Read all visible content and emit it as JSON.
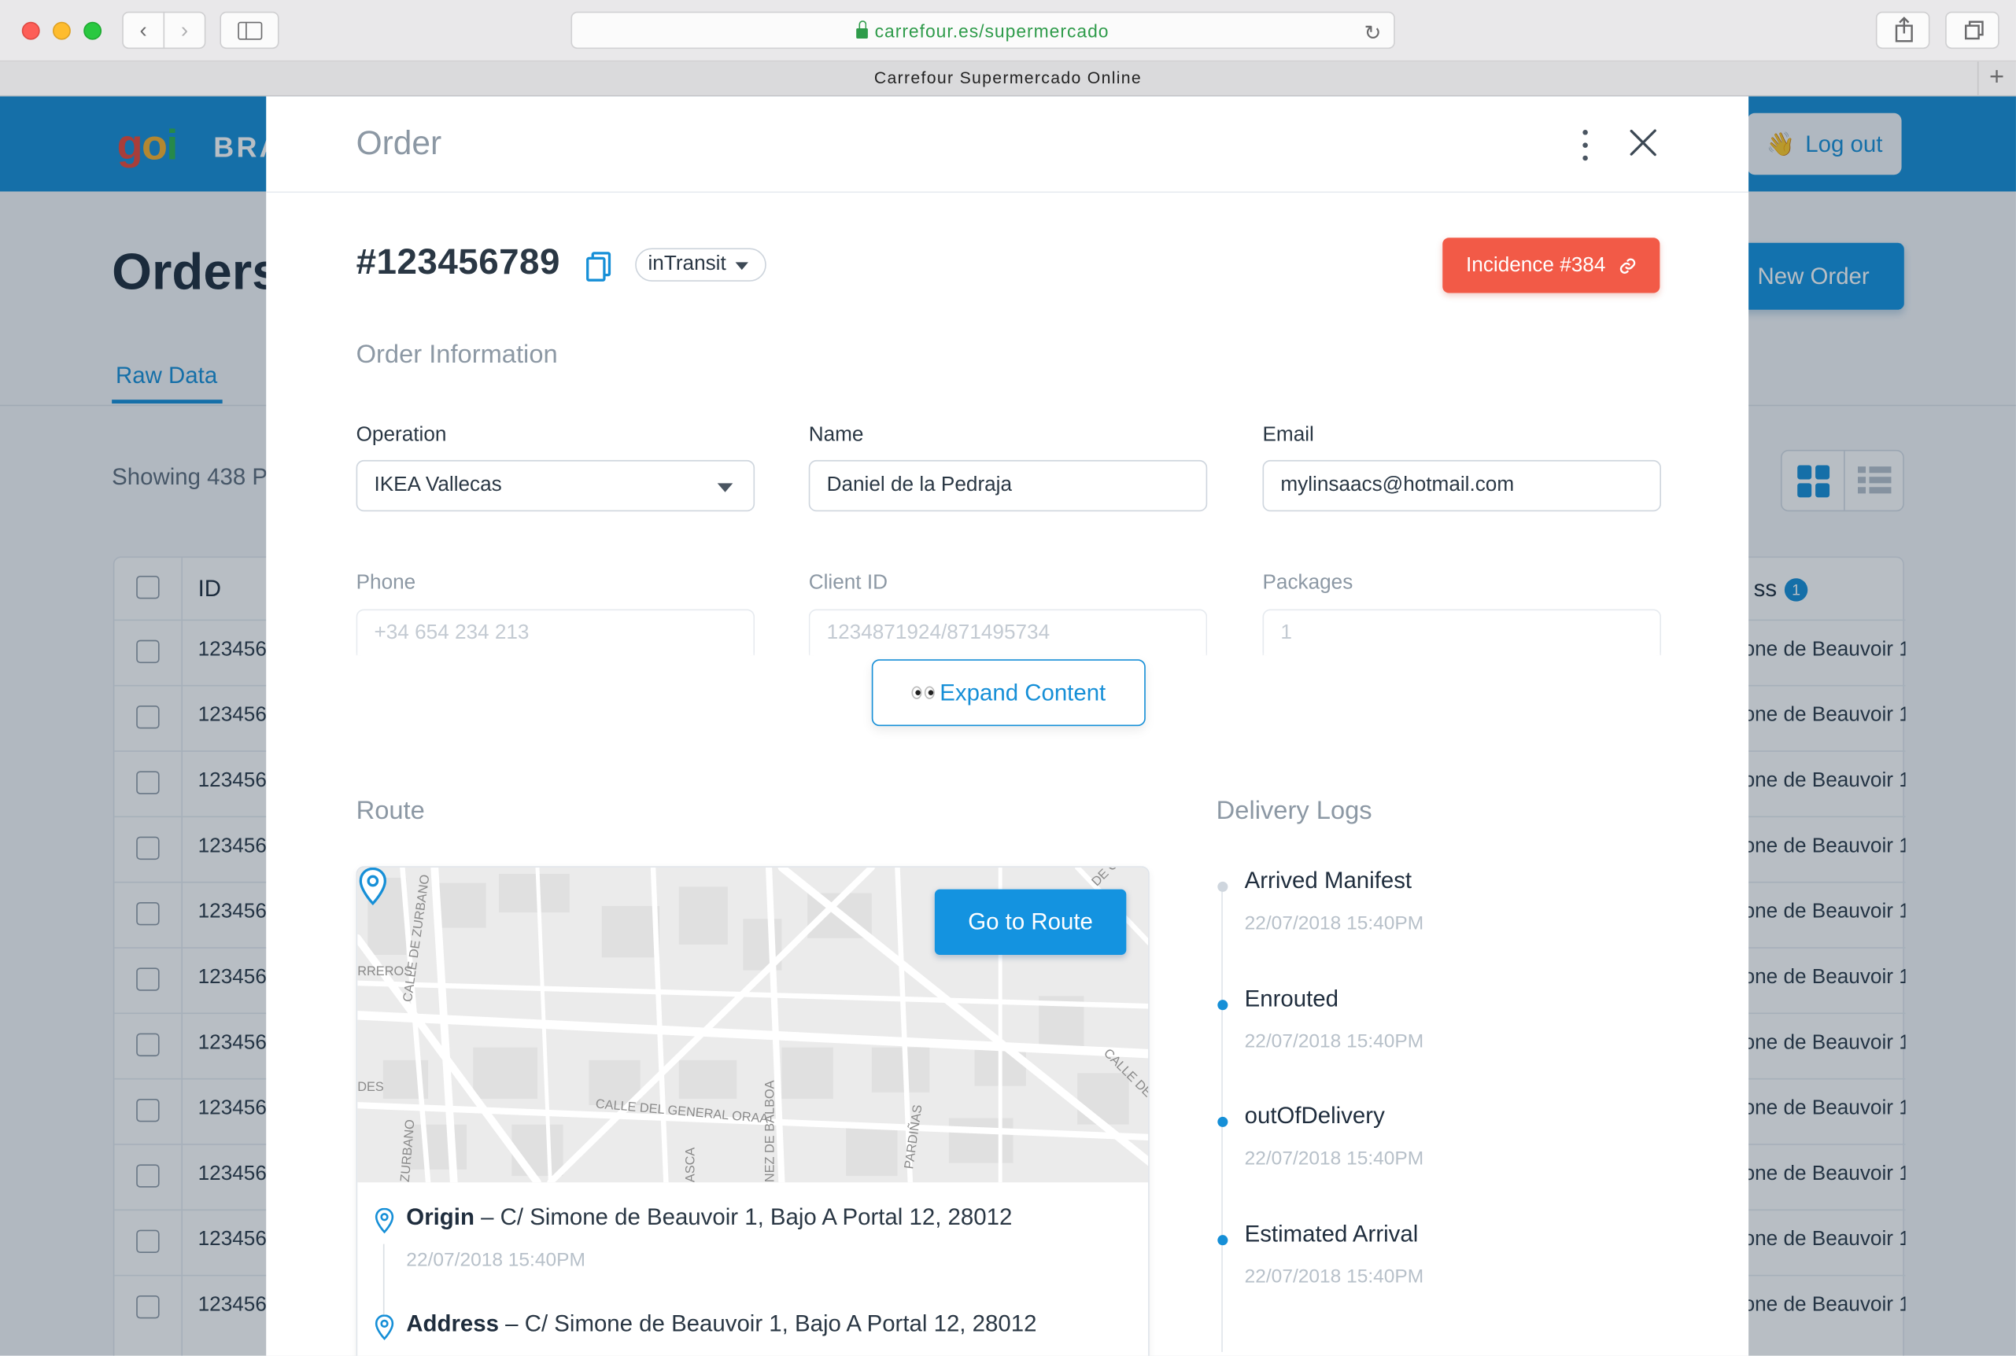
{
  "browser": {
    "url": "carrefour.es/supermercado",
    "tab_title": "Carrefour Supermercado Online",
    "reload_glyph": "↻",
    "newtab_glyph": "+",
    "back_glyph": "‹",
    "forward_glyph": "›"
  },
  "app": {
    "logo": {
      "g": "g",
      "o": "o",
      "i": "i"
    },
    "brand_text": "BRA",
    "logout_emoji": "👋",
    "logout_label": "Log out",
    "page_title": "Orders",
    "new_order_label": "New Order",
    "tab_raw": "Raw Data",
    "showing_text": "Showing 438 P",
    "table": {
      "header_id": "ID",
      "header_address": "ss",
      "header_badge": "1",
      "rows": [
        {
          "id": "123456",
          "address": "one de Beauvoir 1"
        },
        {
          "id": "123456",
          "address": "one de Beauvoir 1"
        },
        {
          "id": "123456",
          "address": "one de Beauvoir 1"
        },
        {
          "id": "123456",
          "address": "one de Beauvoir 1"
        },
        {
          "id": "123456",
          "address": "one de Beauvoir 1"
        },
        {
          "id": "123456",
          "address": "one de Beauvoir 1"
        },
        {
          "id": "123456",
          "address": "one de Beauvoir 1"
        },
        {
          "id": "123456",
          "address": "one de Beauvoir 1"
        },
        {
          "id": "123456",
          "address": "one de Beauvoir 1"
        },
        {
          "id": "123456",
          "address": "one de Beauvoir 1"
        },
        {
          "id": "123456",
          "address": "one de Beauvoir 1"
        }
      ]
    }
  },
  "modal": {
    "title": "Order",
    "order_number": "#123456789",
    "status": "inTransit",
    "incidence_label": "Incidence #384",
    "incidence_link_glyph": "🔗",
    "order_info_title": "Order Information",
    "fields": {
      "operation": {
        "label": "Operation",
        "value": "IKEA Vallecas"
      },
      "name": {
        "label": "Name",
        "value": "Daniel de la Pedraja"
      },
      "email": {
        "label": "Email",
        "value": "mylinsaacs@hotmail.com"
      },
      "phone": {
        "label": "Phone",
        "value": "+34 654 234 213"
      },
      "client_id": {
        "label": "Client ID",
        "value": "1234871924/871495734"
      },
      "packages": {
        "label": "Packages",
        "value": "1"
      }
    },
    "expand_label": "Expand Content",
    "route": {
      "title": "Route",
      "go_to_route_label": "Go to Route",
      "map_labels": [
        "CALLE DE ZURBANO",
        "RREROS",
        "CALLE DEL GENERAL ORAA",
        "NEZ DE BALBOA",
        "PARDIÑAS",
        "ASCA",
        "ZURBANO",
        "DES",
        "CALLE DE",
        "DE C"
      ],
      "stops": [
        {
          "kind": "Origin",
          "sep": " – ",
          "address": "C/ Simone de Beauvoir 1, Bajo A Portal 12, 28012",
          "time": "22/07/2018 15:40PM"
        },
        {
          "kind": "Address",
          "sep": " – ",
          "address": "C/ Simone de Beauvoir 1, Bajo A Portal 12, 28012"
        }
      ]
    },
    "logs": {
      "title": "Delivery Logs",
      "items": [
        {
          "title": "Arrived Manifest",
          "time": "22/07/2018 15:40PM"
        },
        {
          "title": "Enrouted",
          "time": "22/07/2018 15:40PM"
        },
        {
          "title": "outOfDelivery",
          "time": "22/07/2018 15:40PM"
        },
        {
          "title": "Estimated Arrival",
          "time": "22/07/2018 15:40PM"
        }
      ]
    }
  },
  "colors": {
    "accent": "#168fd7",
    "danger": "#f25a47",
    "header": "#168fd7"
  }
}
